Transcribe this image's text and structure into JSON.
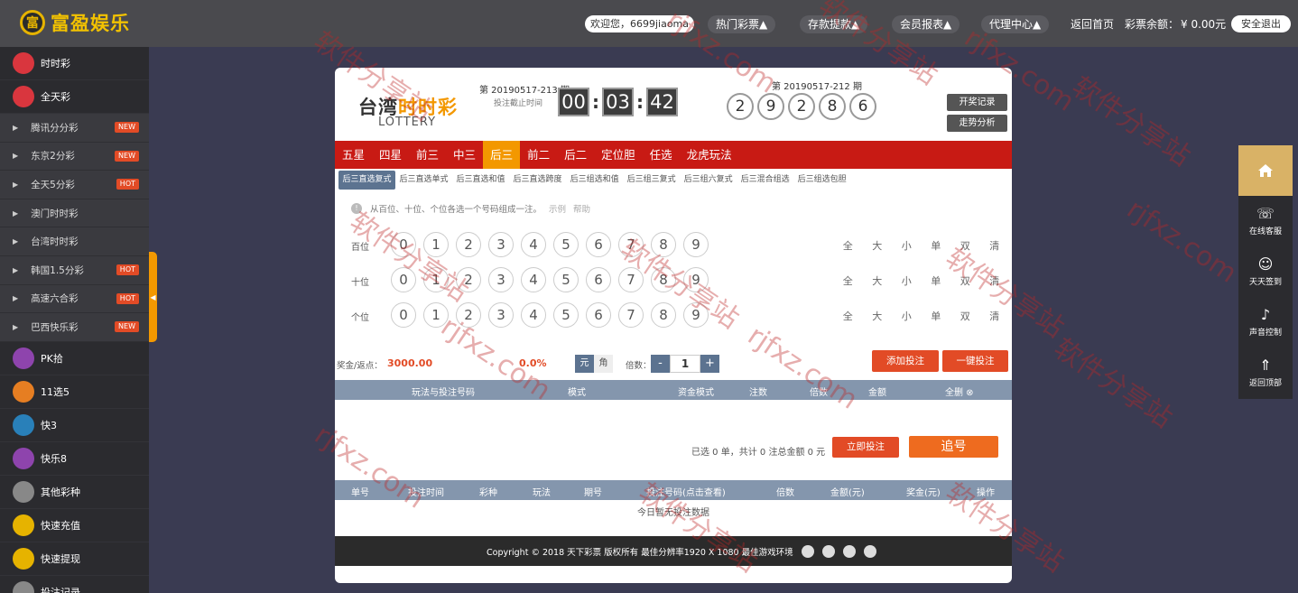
{
  "header": {
    "logo_mark": "富",
    "logo_text": "富盈娱乐",
    "welcome": "欢迎您，6699jiaoma",
    "nav": [
      "热门彩票▲",
      "存款提款▲",
      "会员报表▲",
      "代理中心▲"
    ],
    "home": "返回首页",
    "balance_label": "彩票余额：",
    "balance_value": "¥ 0.00元",
    "logout": "安全退出"
  },
  "sidebar": {
    "top_items": [
      {
        "label": "时时彩",
        "color": "#d9363e"
      },
      {
        "label": "全天彩",
        "color": "#d9363e"
      }
    ],
    "sub_items": [
      {
        "label": "腾讯分分彩",
        "badge": "NEW"
      },
      {
        "label": "东京2分彩",
        "badge": "NEW"
      },
      {
        "label": "全天5分彩",
        "badge": "HOT"
      },
      {
        "label": "澳门时时彩",
        "badge": ""
      },
      {
        "label": "台湾时时彩",
        "badge": ""
      },
      {
        "label": "韩国1.5分彩",
        "badge": "HOT"
      },
      {
        "label": "高速六合彩",
        "badge": "HOT"
      },
      {
        "label": "巴西快乐彩",
        "badge": "NEW"
      }
    ],
    "bottom_items": [
      {
        "label": "PK拾",
        "color": "#8e44ad"
      },
      {
        "label": "11选5",
        "color": "#e67e22"
      },
      {
        "label": "快3",
        "color": "#2980b9"
      },
      {
        "label": "快乐8",
        "color": "#8e44ad"
      },
      {
        "label": "其他彩种",
        "color": "#888888"
      },
      {
        "label": "快速充值",
        "color": "#e6b300"
      },
      {
        "label": "快速提现",
        "color": "#e6b300"
      },
      {
        "label": "投注记录",
        "color": "#888888"
      }
    ],
    "collapse": "◀"
  },
  "game": {
    "brand_cn_a": "台湾",
    "brand_cn_b": "时时彩",
    "brand_en": "LOTTERY",
    "current_issue": "第 20190517-213 期",
    "deadline_label": "投注截止时间",
    "timer": [
      "00",
      "03",
      "42"
    ],
    "last_issue": "第 20190517-212 期",
    "last_result": [
      "2",
      "9",
      "2",
      "8",
      "6"
    ],
    "btn_history": "开奖记录",
    "btn_trend": "走势分析"
  },
  "tabs": {
    "items": [
      "五星",
      "四星",
      "前三",
      "中三",
      "后三",
      "前二",
      "后二",
      "定位胆",
      "任选",
      "龙虎玩法"
    ],
    "active": 4
  },
  "subtabs": [
    "后三直选复式",
    "后三直选单式",
    "后三直选和值",
    "后三直选跨度",
    "后三组选和值",
    "后三组三复式",
    "后三组六复式",
    "后三混合组选",
    "后三组选包胆"
  ],
  "hint": {
    "icon": "!",
    "text": "从百位、十位、个位各选一个号码组成一注。",
    "example": "示例",
    "help": "帮助"
  },
  "rows": [
    {
      "label": "百位"
    },
    {
      "label": "十位"
    },
    {
      "label": "个位"
    }
  ],
  "digits": [
    "0",
    "1",
    "2",
    "3",
    "4",
    "5",
    "6",
    "7",
    "8",
    "9"
  ],
  "quick": [
    "全",
    "大",
    "小",
    "单",
    "双",
    "清"
  ],
  "bet": {
    "rate_label": "奖金/返点：",
    "rate_value": "3000.00",
    "rebate": "0.0%",
    "unit_yuan": "元",
    "unit_jiao": "角",
    "multiple_label": "倍数：",
    "minus": "-",
    "multiple": "1",
    "plus": "+",
    "btn_add": "添加投注",
    "btn_quick": "一键投注"
  },
  "cart": {
    "headers": [
      "玩法与投注号码",
      "模式",
      "资金模式",
      "注数",
      "倍数",
      "金额",
      "全删 ⊗"
    ],
    "summary": "已选 0 单，共计 0 注总金额 0 元",
    "btn_now": "立即投注",
    "btn_chase": "追号"
  },
  "records": {
    "headers": [
      "单号",
      "投注时间",
      "彩种",
      "玩法",
      "期号",
      "投注号码(点击查看)",
      "倍数",
      "金额(元)",
      "奖金(元)",
      "操作"
    ],
    "empty": "今日暂无投注数据"
  },
  "footer": {
    "text": "Copyright © 2018 天下彩票 版权所有    最佳分辨率1920 X 1080 最佳游戏环境"
  },
  "rightbar": [
    {
      "label": "在线客服",
      "icon": "☏"
    },
    {
      "label": "天天签到",
      "icon": "☺"
    },
    {
      "label": "声音控制",
      "icon": "♪"
    },
    {
      "label": "返回顶部",
      "icon": "⇑"
    }
  ],
  "watermark": [
    "软件分享站",
    "rjfxz.com"
  ]
}
